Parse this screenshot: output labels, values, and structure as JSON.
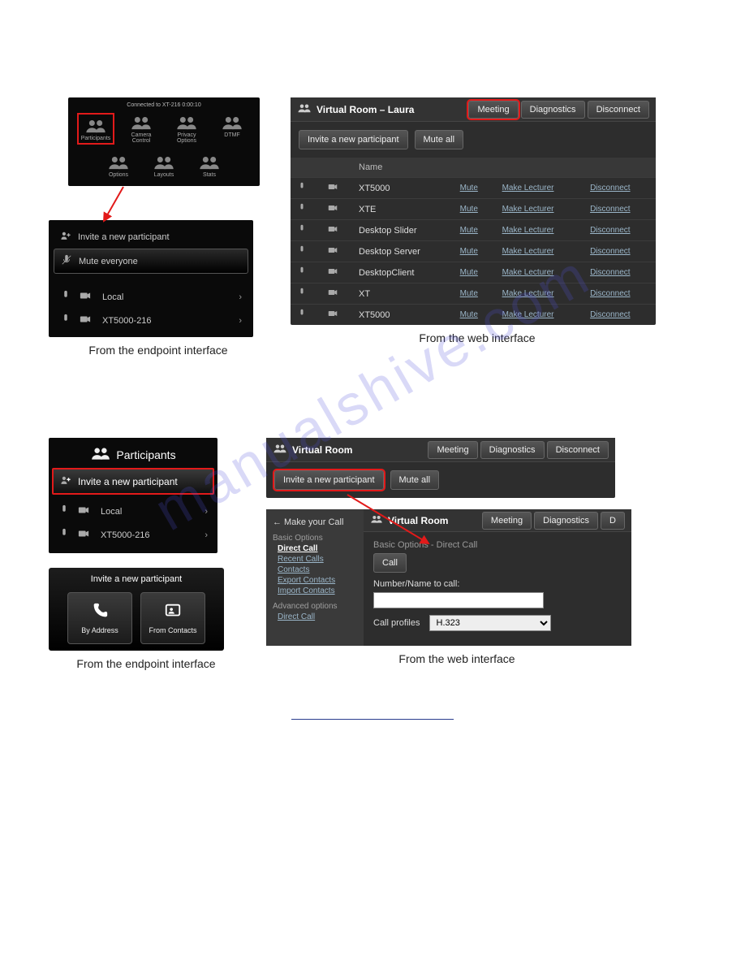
{
  "watermark": "manualshive.com",
  "endpoint_top": {
    "status": "Connected to XT-216\n0:00:10",
    "cells": [
      {
        "label": "Participants",
        "highlight": true
      },
      {
        "label": "Camera Control"
      },
      {
        "label": "Privacy Options"
      },
      {
        "label": "DTMF"
      },
      {
        "label": "Options"
      },
      {
        "label": "Layouts"
      },
      {
        "label": "Stats"
      }
    ]
  },
  "endpoint_mid": {
    "rows": [
      {
        "label": "Invite a new participant",
        "kind": "invite"
      },
      {
        "label": "Mute everyone",
        "kind": "mute",
        "selected": true
      }
    ],
    "list": [
      {
        "label": "Local"
      },
      {
        "label": "XT5000-216"
      }
    ]
  },
  "caption_left": "From the endpoint interface",
  "caption_right": "From the web interface",
  "web1": {
    "title": "Virtual Room – Laura",
    "tabs": [
      {
        "label": "Meeting",
        "highlight": true
      },
      {
        "label": "Diagnostics"
      },
      {
        "label": "Disconnect"
      }
    ],
    "toolbar": [
      {
        "label": "Invite a new participant"
      },
      {
        "label": "Mute all"
      }
    ],
    "columns": {
      "name": "Name",
      "mute": "Mute",
      "lecturer": "Make Lecturer",
      "disconnect": "Disconnect"
    },
    "rows": [
      {
        "name": "XT5000"
      },
      {
        "name": "XTE"
      },
      {
        "name": "Desktop Slider"
      },
      {
        "name": "Desktop Server"
      },
      {
        "name": "DesktopClient"
      },
      {
        "name": "XT"
      },
      {
        "name": "XT5000"
      }
    ]
  },
  "endpoint2": {
    "header": "Participants",
    "invite": "Invite a new participant",
    "list": [
      {
        "label": "Local"
      },
      {
        "label": "XT5000-216"
      }
    ],
    "invite_panel": {
      "title": "Invite a new participant",
      "by_address": "By Address",
      "from_contacts": "From Contacts"
    }
  },
  "web2_top": {
    "title": "Virtual Room",
    "tabs": [
      {
        "label": "Meeting"
      },
      {
        "label": "Diagnostics"
      },
      {
        "label": "Disconnect"
      }
    ],
    "toolbar": [
      {
        "label": "Invite a new participant",
        "highlight": true
      },
      {
        "label": "Mute all"
      }
    ]
  },
  "web2_bottom": {
    "side": {
      "header": "← Make your Call",
      "basic_label": "Basic Options",
      "links": [
        {
          "label": "Direct Call",
          "selected": true
        },
        {
          "label": "Recent Calls"
        },
        {
          "label": "Contacts"
        },
        {
          "label": "Export Contacts"
        },
        {
          "label": "Import Contacts"
        }
      ],
      "adv_label": "Advanced options",
      "adv_links": [
        {
          "label": "Direct Call"
        }
      ]
    },
    "main": {
      "title": "Virtual Room",
      "tabs": [
        {
          "label": "Meeting"
        },
        {
          "label": "Diagnostics"
        },
        {
          "label": "D"
        }
      ],
      "subheader": "Basic Options - Direct Call",
      "call_btn": "Call",
      "number_label": "Number/Name to call:",
      "profiles_label": "Call profiles",
      "profiles_value": "H.323"
    }
  }
}
